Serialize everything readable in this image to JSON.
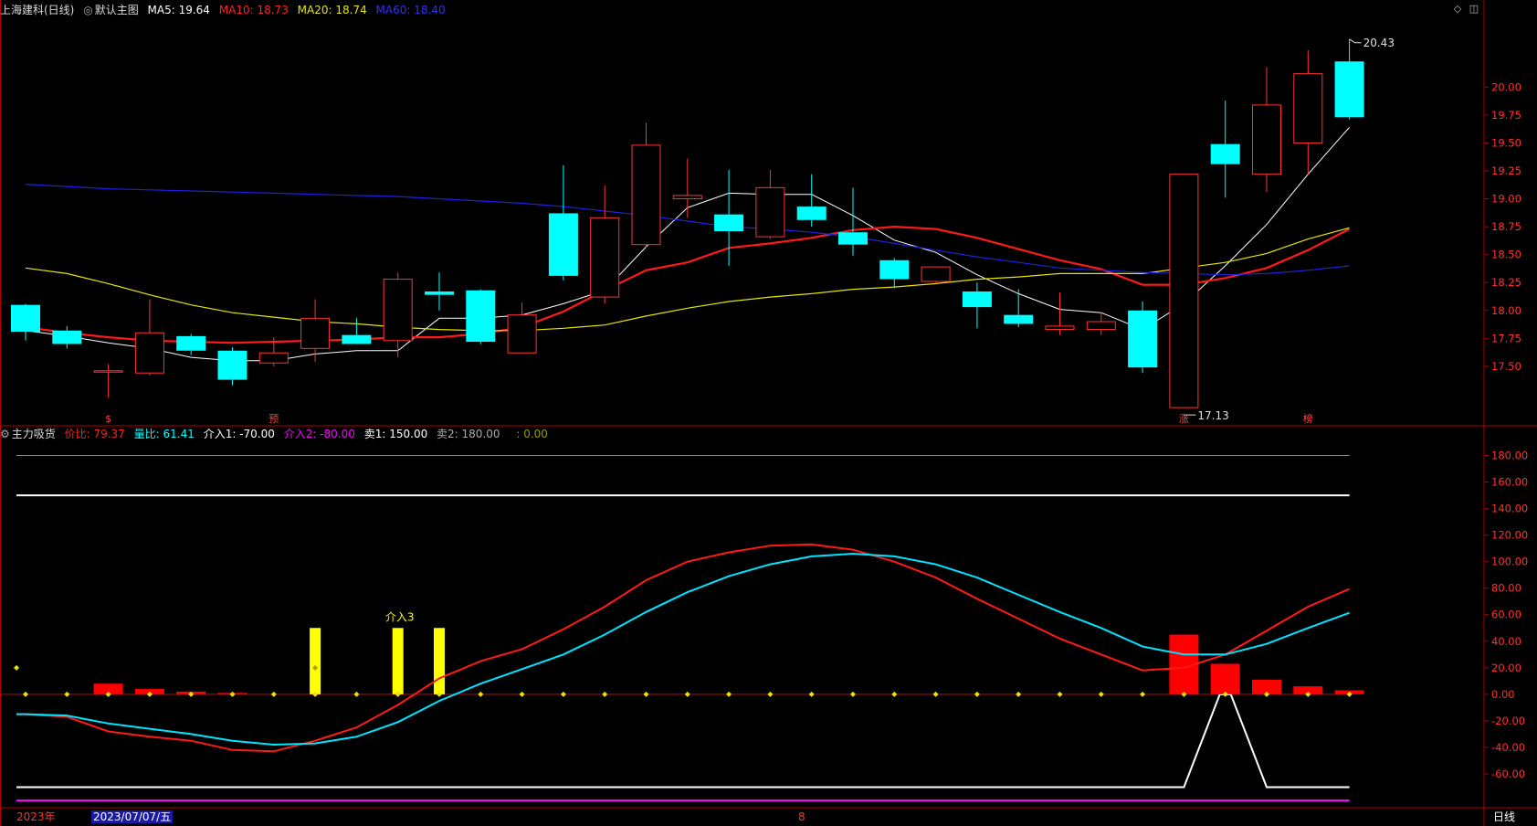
{
  "main_header": {
    "stock": "上海建科(日线)",
    "template": "默认主图",
    "ma5": "MA5: 19.64",
    "ma10": "MA10: 18.73",
    "ma20": "MA20: 18.74",
    "ma60": "MA60: 18.40"
  },
  "sub_header": {
    "name": "主力吸货",
    "jiabi": "价比: 79.37",
    "liangbi": "量比: 61.41",
    "jieru1": "介入1: -70.00",
    "jieru2": "介入2: -80.00",
    "mai1": "卖1: 150.00",
    "mai2": "卖2: 180.00",
    "blank": ": 0.00"
  },
  "footer": {
    "year": "2023年",
    "cursor_date": "2023/07/07/五",
    "month_mark": "8",
    "period": "日线"
  },
  "colors": {
    "up": "#ff3232",
    "down": "#00ffff",
    "ma5": "#ffffff",
    "ma10": "#ff1a1a",
    "ma20": "#e6e600",
    "ma60": "#2020e0",
    "border": "#b00000",
    "magenta": "#ff00ff",
    "signal_yellow": "#ffff00"
  },
  "chart_data": [
    {
      "type": "candlestick",
      "ylim": [
        17.0,
        20.6
      ],
      "yticks": [
        17.5,
        17.75,
        18.0,
        18.25,
        18.5,
        18.75,
        19.0,
        19.25,
        19.5,
        19.75,
        20.0
      ],
      "ytick_labels": [
        "17.50",
        "17.75",
        "18.00",
        "18.25",
        "18.50",
        "18.75",
        "19.00",
        "19.25",
        "19.50",
        "19.75",
        "20.00"
      ],
      "high_mark": "20.43",
      "low_mark": "17.13",
      "markers": [
        {
          "label": "$",
          "index": 2
        },
        {
          "label": "预",
          "index": 6
        },
        {
          "label": "涨",
          "index": 28
        },
        {
          "label": "榜",
          "index": 31
        }
      ],
      "candles": [
        {
          "o": 18.05,
          "h": 18.06,
          "l": 17.73,
          "c": 17.81
        },
        {
          "o": 17.82,
          "h": 17.86,
          "l": 17.66,
          "c": 17.7
        },
        {
          "o": 17.45,
          "h": 17.52,
          "l": 17.22,
          "c": 17.46
        },
        {
          "o": 17.44,
          "h": 18.1,
          "l": 17.42,
          "c": 17.8
        },
        {
          "o": 17.77,
          "h": 17.79,
          "l": 17.6,
          "c": 17.64
        },
        {
          "o": 17.64,
          "h": 17.67,
          "l": 17.33,
          "c": 17.38
        },
        {
          "o": 17.53,
          "h": 17.76,
          "l": 17.5,
          "c": 17.62
        },
        {
          "o": 17.66,
          "h": 18.1,
          "l": 17.54,
          "c": 17.93
        },
        {
          "o": 17.78,
          "h": 17.93,
          "l": 17.72,
          "c": 17.7
        },
        {
          "o": 17.73,
          "h": 18.34,
          "l": 17.58,
          "c": 18.28
        },
        {
          "o": 18.17,
          "h": 18.34,
          "l": 18.0,
          "c": 18.14
        },
        {
          "o": 18.18,
          "h": 18.19,
          "l": 17.7,
          "c": 17.72
        },
        {
          "o": 17.62,
          "h": 18.07,
          "l": 17.62,
          "c": 17.96
        },
        {
          "o": 18.87,
          "h": 19.3,
          "l": 18.27,
          "c": 18.31
        },
        {
          "o": 18.12,
          "h": 19.12,
          "l": 18.06,
          "c": 18.83
        },
        {
          "o": 18.59,
          "h": 19.68,
          "l": 18.56,
          "c": 19.48
        },
        {
          "o": 19.0,
          "h": 19.36,
          "l": 18.83,
          "c": 19.03
        },
        {
          "o": 18.86,
          "h": 19.26,
          "l": 18.4,
          "c": 18.71
        },
        {
          "o": 18.66,
          "h": 19.26,
          "l": 18.64,
          "c": 19.1
        },
        {
          "o": 18.93,
          "h": 19.22,
          "l": 18.75,
          "c": 18.81
        },
        {
          "o": 18.7,
          "h": 19.1,
          "l": 18.49,
          "c": 18.59
        },
        {
          "o": 18.45,
          "h": 18.47,
          "l": 18.2,
          "c": 18.28
        },
        {
          "o": 18.26,
          "h": 18.39,
          "l": 18.25,
          "c": 18.39
        },
        {
          "o": 18.17,
          "h": 18.25,
          "l": 17.84,
          "c": 18.03
        },
        {
          "o": 17.96,
          "h": 18.19,
          "l": 17.85,
          "c": 17.88
        },
        {
          "o": 17.83,
          "h": 18.16,
          "l": 17.78,
          "c": 17.86
        },
        {
          "o": 17.83,
          "h": 17.98,
          "l": 17.78,
          "c": 17.9
        },
        {
          "o": 18.0,
          "h": 18.08,
          "l": 17.44,
          "c": 17.49
        },
        {
          "o": 17.13,
          "h": 19.22,
          "l": 17.13,
          "c": 19.22
        },
        {
          "o": 19.49,
          "h": 19.88,
          "l": 19.01,
          "c": 19.31
        },
        {
          "o": 19.22,
          "h": 20.18,
          "l": 19.06,
          "c": 19.84
        },
        {
          "o": 19.5,
          "h": 20.33,
          "l": 19.22,
          "c": 20.12
        },
        {
          "o": 20.23,
          "h": 20.43,
          "l": 19.71,
          "c": 19.73
        }
      ],
      "series": [
        {
          "name": "MA5",
          "values": [
            17.82,
            17.77,
            17.71,
            17.66,
            17.58,
            17.55,
            17.55,
            17.61,
            17.64,
            17.64,
            17.93,
            17.93,
            17.96,
            18.06,
            18.18,
            18.57,
            18.92,
            19.05,
            19.04,
            19.04,
            18.85,
            18.63,
            18.52,
            18.32,
            18.15,
            18.01,
            17.98,
            17.83,
            18.06,
            18.4,
            18.77,
            19.22,
            19.64
          ]
        },
        {
          "name": "MA10",
          "values": [
            17.85,
            17.8,
            17.76,
            17.73,
            17.72,
            17.71,
            17.72,
            17.73,
            17.74,
            17.76,
            17.76,
            17.79,
            17.85,
            17.99,
            18.18,
            18.36,
            18.43,
            18.56,
            18.6,
            18.65,
            18.72,
            18.75,
            18.73,
            18.65,
            18.55,
            18.45,
            18.37,
            18.23,
            18.23,
            18.29,
            18.38,
            18.54,
            18.73
          ]
        },
        {
          "name": "MA20",
          "values": [
            18.38,
            18.33,
            18.24,
            18.14,
            18.05,
            17.98,
            17.94,
            17.9,
            17.88,
            17.85,
            17.83,
            17.82,
            17.82,
            17.84,
            17.87,
            17.95,
            18.02,
            18.08,
            18.12,
            18.15,
            18.19,
            18.21,
            18.24,
            18.28,
            18.3,
            18.33,
            18.33,
            18.33,
            18.38,
            18.43,
            18.51,
            18.64,
            18.74
          ]
        },
        {
          "name": "MA60",
          "values": [
            19.13,
            19.11,
            19.09,
            19.08,
            19.07,
            19.06,
            19.05,
            19.04,
            19.03,
            19.02,
            19.0,
            18.98,
            18.96,
            18.93,
            18.89,
            18.85,
            18.8,
            18.75,
            18.73,
            18.7,
            18.66,
            18.6,
            18.54,
            18.48,
            18.43,
            18.38,
            18.36,
            18.34,
            18.33,
            18.32,
            18.33,
            18.36,
            18.4
          ]
        }
      ]
    },
    {
      "type": "indicator",
      "ylim": [
        -80,
        190
      ],
      "yticks": [
        -60,
        -40,
        -20,
        0,
        20,
        40,
        60,
        80,
        100,
        120,
        140,
        160,
        180
      ],
      "ytick_labels": [
        "-60.00",
        "-40.00",
        "-20.00",
        "0.00",
        "20.00",
        "40.00",
        "60.00",
        "80.00",
        "100.00",
        "120.00",
        "140.00",
        "160.00",
        "180.00"
      ],
      "annotation": {
        "label": "介入3",
        "index": 9
      },
      "levels": {
        "mai2": 180,
        "mai1": 150,
        "jieru1": -70,
        "jieru2": -80
      },
      "series": [
        {
          "name": "价比",
          "values": [
            -15,
            -17,
            -28,
            -32,
            -35,
            -42,
            -43,
            -35,
            -25,
            -8,
            12,
            25,
            34,
            49,
            66,
            86,
            100,
            107,
            112,
            113,
            109,
            100,
            88,
            72,
            57,
            42,
            30,
            18,
            20,
            30,
            48,
            66,
            79.37
          ]
        },
        {
          "name": "量比",
          "values": [
            -15,
            -16,
            -22,
            -26,
            -30,
            -35,
            -38,
            -37,
            -32,
            -21,
            -5,
            8,
            19,
            30,
            45,
            62,
            77,
            89,
            98,
            104,
            106,
            104,
            98,
            88,
            75,
            62,
            50,
            36,
            30,
            30,
            38,
            50,
            61.41
          ]
        }
      ],
      "red_bars": [
        {
          "index": 2,
          "v": 8
        },
        {
          "index": 3,
          "v": 4
        },
        {
          "index": 4,
          "v": 2
        },
        {
          "index": 5,
          "v": 1
        },
        {
          "index": 28,
          "v": 45
        },
        {
          "index": 29,
          "v": 23
        },
        {
          "index": 30,
          "v": 11
        },
        {
          "index": 31,
          "v": 6
        },
        {
          "index": 32,
          "v": 3
        }
      ],
      "yellow_bars": [
        {
          "index": 7,
          "v": 50
        },
        {
          "index": 9,
          "v": 50
        },
        {
          "index": 10,
          "v": 50
        }
      ],
      "spike": {
        "start_index": 28,
        "peak_index": 29,
        "end_index": 30,
        "base": -70,
        "peak": 0
      }
    }
  ]
}
